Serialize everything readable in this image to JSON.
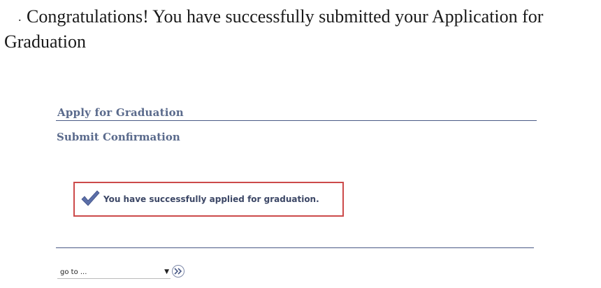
{
  "header": {
    "bullet": ".",
    "message": "Congratulations!  You have successfully submitted your Application for Graduation"
  },
  "page": {
    "title": "Apply for Graduation",
    "subtitle": "Submit Confirmation"
  },
  "confirmation": {
    "icon": "checkmark-icon",
    "message": "You have successfully applied for graduation.",
    "border_color": "#cc4a4a",
    "check_color": "#5b6fa8"
  },
  "footer": {
    "goto_label": "go to ...",
    "goto_icon": "double-chevron-right-icon"
  },
  "colors": {
    "title": "#5a6a8c",
    "rule": "#4a5a86"
  }
}
